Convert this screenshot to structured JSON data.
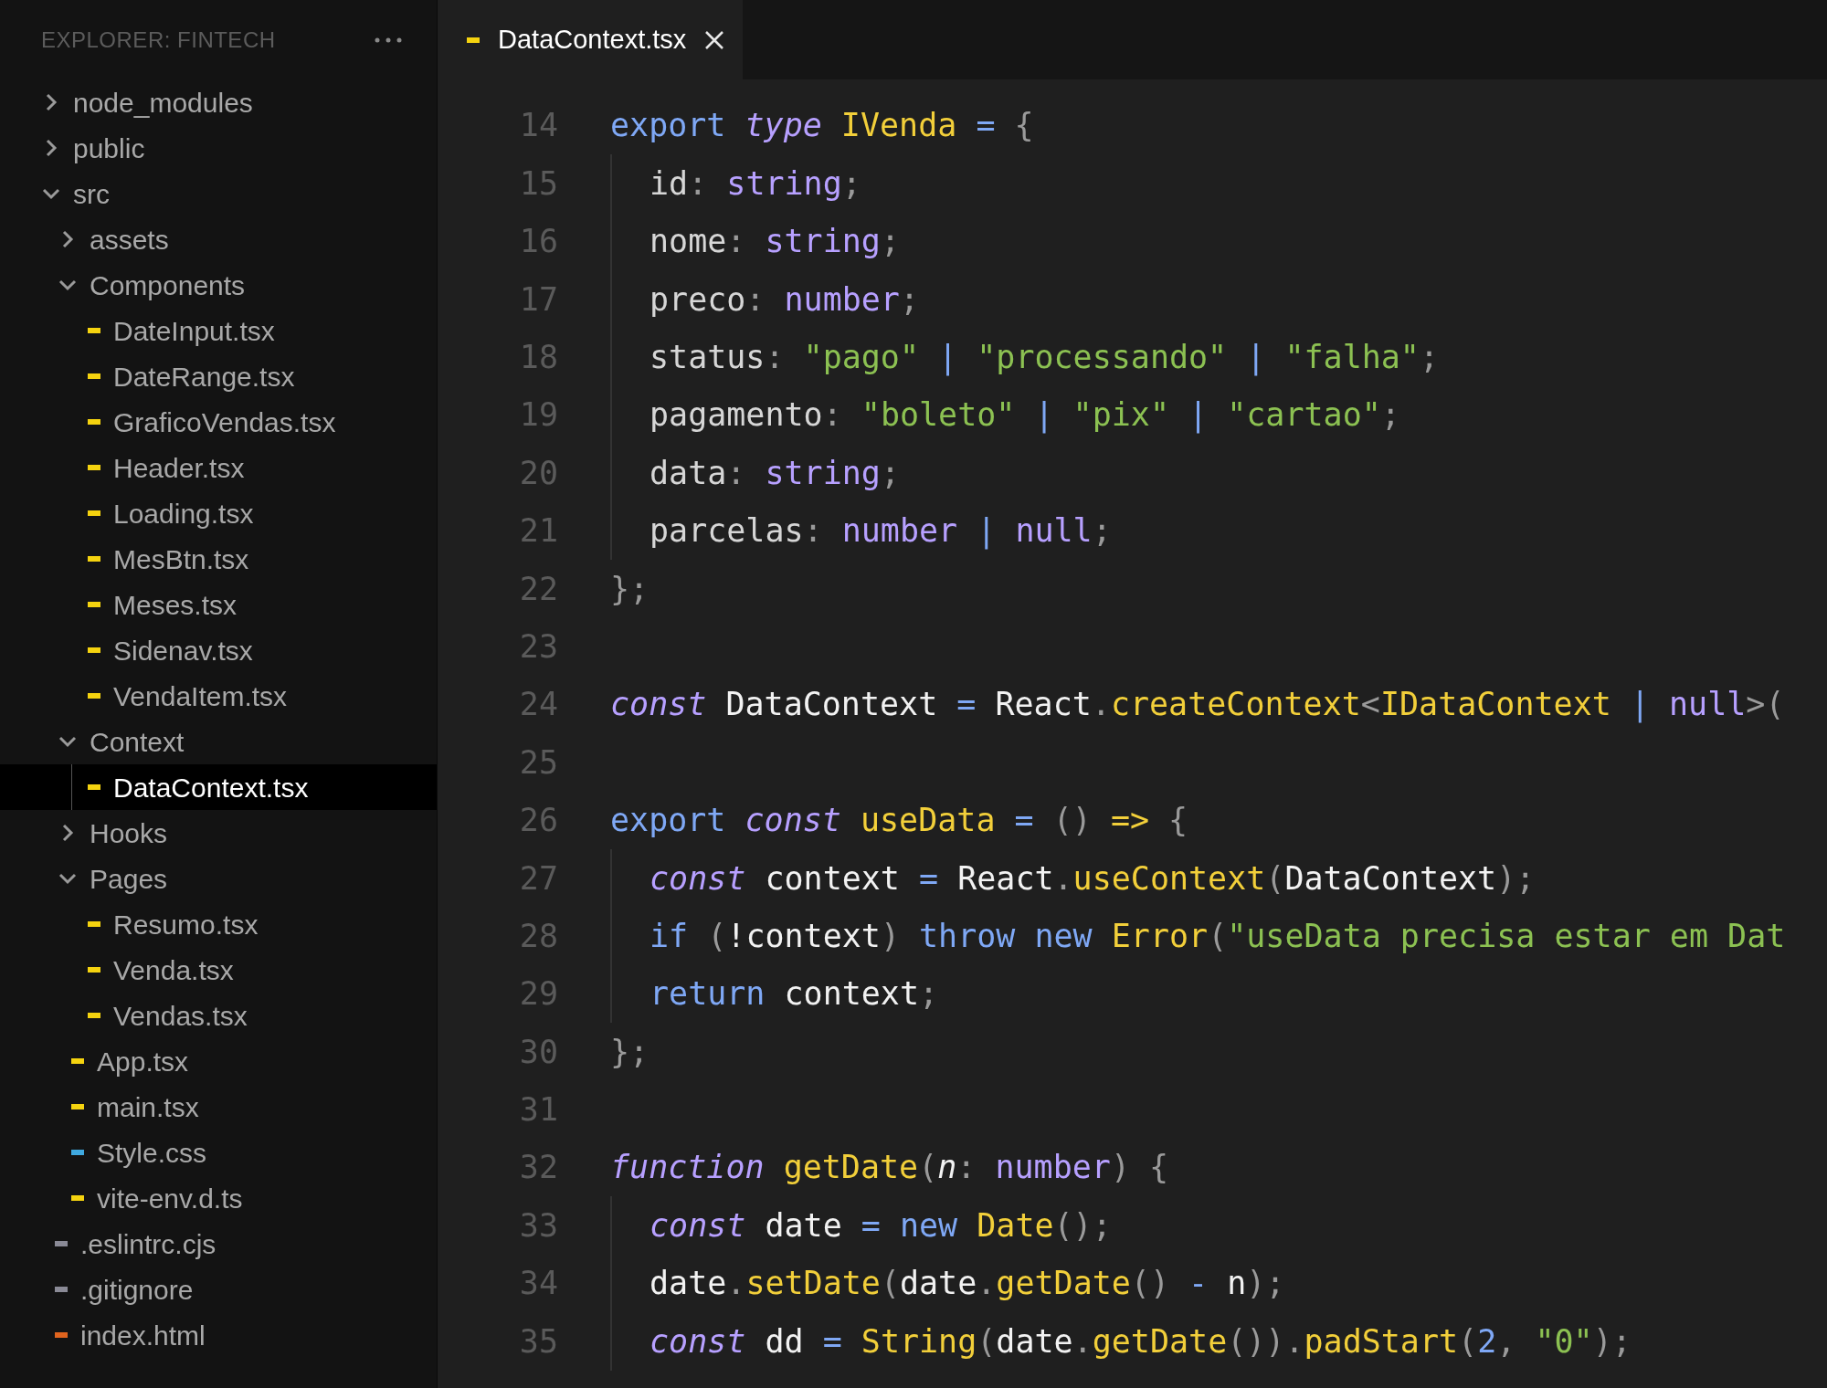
{
  "explorer": {
    "title": "EXPLORER: FINTECH",
    "tree": [
      {
        "name": "node_modules",
        "kind": "folder",
        "expanded": false,
        "selected": false
      },
      {
        "name": "public",
        "kind": "folder",
        "expanded": false,
        "selected": false
      },
      {
        "name": "src",
        "kind": "folder",
        "expanded": true,
        "selected": false,
        "children": [
          {
            "name": "assets",
            "kind": "folder",
            "expanded": false,
            "selected": false
          },
          {
            "name": "Components",
            "kind": "folder",
            "expanded": true,
            "selected": false,
            "children": [
              {
                "name": "DateInput.tsx",
                "kind": "file",
                "color": "#f5d30f",
                "selected": false
              },
              {
                "name": "DateRange.tsx",
                "kind": "file",
                "color": "#f5d30f",
                "selected": false
              },
              {
                "name": "GraficoVendas.tsx",
                "kind": "file",
                "color": "#f5d30f",
                "selected": false
              },
              {
                "name": "Header.tsx",
                "kind": "file",
                "color": "#f5d30f",
                "selected": false
              },
              {
                "name": "Loading.tsx",
                "kind": "file",
                "color": "#f5d30f",
                "selected": false
              },
              {
                "name": "MesBtn.tsx",
                "kind": "file",
                "color": "#f5d30f",
                "selected": false
              },
              {
                "name": "Meses.tsx",
                "kind": "file",
                "color": "#f5d30f",
                "selected": false
              },
              {
                "name": "Sidenav.tsx",
                "kind": "file",
                "color": "#f5d30f",
                "selected": false
              },
              {
                "name": "VendaItem.tsx",
                "kind": "file",
                "color": "#f5d30f",
                "selected": false
              }
            ]
          },
          {
            "name": "Context",
            "kind": "folder",
            "expanded": true,
            "selected": false,
            "children": [
              {
                "name": "DataContext.tsx",
                "kind": "file",
                "color": "#f5d30f",
                "selected": true
              }
            ]
          },
          {
            "name": "Hooks",
            "kind": "folder",
            "expanded": false,
            "selected": false
          },
          {
            "name": "Pages",
            "kind": "folder",
            "expanded": true,
            "selected": false,
            "children": [
              {
                "name": "Resumo.tsx",
                "kind": "file",
                "color": "#f5d30f",
                "selected": false
              },
              {
                "name": "Venda.tsx",
                "kind": "file",
                "color": "#f5d30f",
                "selected": false
              },
              {
                "name": "Vendas.tsx",
                "kind": "file",
                "color": "#f5d30f",
                "selected": false
              }
            ]
          },
          {
            "name": "App.tsx",
            "kind": "file",
            "color": "#f5d30f",
            "selected": false
          },
          {
            "name": "main.tsx",
            "kind": "file",
            "color": "#f5d30f",
            "selected": false
          },
          {
            "name": "Style.css",
            "kind": "file",
            "color": "#3fa9e0",
            "selected": false
          },
          {
            "name": "vite-env.d.ts",
            "kind": "file",
            "color": "#f5d30f",
            "selected": false
          }
        ]
      },
      {
        "name": ".eslintrc.cjs",
        "kind": "file",
        "color": "#8a8a96",
        "selected": false
      },
      {
        "name": ".gitignore",
        "kind": "file",
        "color": "#8a8a96",
        "selected": false
      },
      {
        "name": "index.html",
        "kind": "file",
        "color": "#e0641e",
        "selected": false
      }
    ]
  },
  "tabs": [
    {
      "label": "DataContext.tsx",
      "color": "#f5d30f",
      "selected": true
    }
  ],
  "code": [
    {
      "n": "14",
      "tokens": [
        {
          "text": "export",
          "kind": "kw"
        },
        {
          "text": " type",
          "kind": "st"
        },
        {
          "text": " IVenda",
          "kind": "fn"
        },
        {
          "text": " =",
          "kind": "op"
        },
        {
          "text": " {",
          "kind": "pu"
        }
      ],
      "children": [
        {
          "n": "15",
          "tokens": [
            {
              "text": "id",
              "kind": "pr"
            },
            {
              "text": ":",
              "kind": "pu"
            },
            {
              "text": " string",
              "kind": "ty"
            },
            {
              "text": ";",
              "kind": "pu"
            }
          ]
        },
        {
          "n": "16",
          "tokens": [
            {
              "text": "nome",
              "kind": "pr"
            },
            {
              "text": ":",
              "kind": "pu"
            },
            {
              "text": " string",
              "kind": "ty"
            },
            {
              "text": ";",
              "kind": "pu"
            }
          ]
        },
        {
          "n": "17",
          "tokens": [
            {
              "text": "preco",
              "kind": "pr"
            },
            {
              "text": ":",
              "kind": "pu"
            },
            {
              "text": " number",
              "kind": "ty"
            },
            {
              "text": ";",
              "kind": "pu"
            }
          ]
        },
        {
          "n": "18",
          "tokens": [
            {
              "text": "status",
              "kind": "pr"
            },
            {
              "text": ":",
              "kind": "pu"
            },
            {
              "text": " \"pago\"",
              "kind": "s"
            },
            {
              "text": " |",
              "kind": "op"
            },
            {
              "text": " \"processando\"",
              "kind": "s"
            },
            {
              "text": " |",
              "kind": "op"
            },
            {
              "text": " \"falha\"",
              "kind": "s"
            },
            {
              "text": ";",
              "kind": "pu"
            }
          ]
        },
        {
          "n": "19",
          "tokens": [
            {
              "text": "pagamento",
              "kind": "pr"
            },
            {
              "text": ":",
              "kind": "pu"
            },
            {
              "text": " \"boleto\"",
              "kind": "s"
            },
            {
              "text": " |",
              "kind": "op"
            },
            {
              "text": " \"pix\"",
              "kind": "s"
            },
            {
              "text": " |",
              "kind": "op"
            },
            {
              "text": " \"cartao\"",
              "kind": "s"
            },
            {
              "text": ";",
              "kind": "pu"
            }
          ]
        },
        {
          "n": "20",
          "tokens": [
            {
              "text": "data",
              "kind": "pr"
            },
            {
              "text": ":",
              "kind": "pu"
            },
            {
              "text": " string",
              "kind": "ty"
            },
            {
              "text": ";",
              "kind": "pu"
            }
          ]
        },
        {
          "n": "21",
          "tokens": [
            {
              "text": "parcelas",
              "kind": "pr"
            },
            {
              "text": ":",
              "kind": "pu"
            },
            {
              "text": " number",
              "kind": "ty"
            },
            {
              "text": " |",
              "kind": "op"
            },
            {
              "text": " null",
              "kind": "ty"
            },
            {
              "text": ";",
              "kind": "pu"
            }
          ]
        }
      ]
    },
    {
      "n": "22",
      "tokens": [
        {
          "text": "};",
          "kind": "pu"
        }
      ]
    },
    {
      "n": "23"
    },
    {
      "n": "24",
      "tokens": [
        {
          "text": "const",
          "kind": "st"
        },
        {
          "text": " DataContext",
          "kind": "id"
        },
        {
          "text": " =",
          "kind": "op"
        },
        {
          "text": " React",
          "kind": "id"
        },
        {
          "text": ".",
          "kind": "pu"
        },
        {
          "text": "createContext",
          "kind": "fn"
        },
        {
          "text": "<",
          "kind": "pu"
        },
        {
          "text": "IDataContext",
          "kind": "fn"
        },
        {
          "text": " |",
          "kind": "op"
        },
        {
          "text": " null",
          "kind": "ty"
        },
        {
          "text": ">(",
          "kind": "pu"
        }
      ]
    },
    {
      "n": "25"
    },
    {
      "n": "26",
      "tokens": [
        {
          "text": "export",
          "kind": "kw"
        },
        {
          "text": " const",
          "kind": "st"
        },
        {
          "text": " useData",
          "kind": "fn"
        },
        {
          "text": " =",
          "kind": "op"
        },
        {
          "text": " ()",
          "kind": "pu"
        },
        {
          "text": " =>",
          "kind": "fn"
        },
        {
          "text": " {",
          "kind": "pu"
        }
      ],
      "children": [
        {
          "n": "27",
          "tokens": [
            {
              "text": "const",
              "kind": "st"
            },
            {
              "text": " context",
              "kind": "id"
            },
            {
              "text": " =",
              "kind": "op"
            },
            {
              "text": " React",
              "kind": "id"
            },
            {
              "text": ".",
              "kind": "pu"
            },
            {
              "text": "useContext",
              "kind": "fn"
            },
            {
              "text": "(",
              "kind": "pu"
            },
            {
              "text": "DataContext",
              "kind": "id"
            },
            {
              "text": ");",
              "kind": "pu"
            }
          ]
        },
        {
          "n": "28",
          "tokens": [
            {
              "text": "if",
              "kind": "kw"
            },
            {
              "text": " (",
              "kind": "pu"
            },
            {
              "text": "!context",
              "kind": "id"
            },
            {
              "text": ")",
              "kind": "pu"
            },
            {
              "text": " throw new",
              "kind": "kw"
            },
            {
              "text": " Error",
              "kind": "fn"
            },
            {
              "text": "(",
              "kind": "pu"
            },
            {
              "text": "\"useData precisa estar em Dat",
              "kind": "s"
            }
          ]
        },
        {
          "n": "29",
          "tokens": [
            {
              "text": "return",
              "kind": "kw"
            },
            {
              "text": " context",
              "kind": "id"
            },
            {
              "text": ";",
              "kind": "pu"
            }
          ]
        }
      ]
    },
    {
      "n": "30",
      "tokens": [
        {
          "text": "};",
          "kind": "pu"
        }
      ]
    },
    {
      "n": "31"
    },
    {
      "n": "32",
      "tokens": [
        {
          "text": "function",
          "kind": "st"
        },
        {
          "text": " getDate",
          "kind": "fn"
        },
        {
          "text": "(",
          "kind": "pu"
        },
        {
          "text": "n",
          "kind": "pi"
        },
        {
          "text": ":",
          "kind": "pu"
        },
        {
          "text": " number",
          "kind": "ty"
        },
        {
          "text": ") {",
          "kind": "pu"
        }
      ],
      "children": [
        {
          "n": "33",
          "tokens": [
            {
              "text": "const",
              "kind": "st"
            },
            {
              "text": " date",
              "kind": "id"
            },
            {
              "text": " =",
              "kind": "op"
            },
            {
              "text": " new",
              "kind": "kw"
            },
            {
              "text": " Date",
              "kind": "fn"
            },
            {
              "text": "();",
              "kind": "pu"
            }
          ]
        },
        {
          "n": "34",
          "tokens": [
            {
              "text": "date",
              "kind": "id"
            },
            {
              "text": ".",
              "kind": "pu"
            },
            {
              "text": "setDate",
              "kind": "fn"
            },
            {
              "text": "(",
              "kind": "pu"
            },
            {
              "text": "date",
              "kind": "id"
            },
            {
              "text": ".",
              "kind": "pu"
            },
            {
              "text": "getDate",
              "kind": "fn"
            },
            {
              "text": "()",
              "kind": "pu"
            },
            {
              "text": " -",
              "kind": "op"
            },
            {
              "text": " n",
              "kind": "id"
            },
            {
              "text": ");",
              "kind": "pu"
            }
          ]
        },
        {
          "n": "35",
          "tokens": [
            {
              "text": "const",
              "kind": "st"
            },
            {
              "text": " dd",
              "kind": "id"
            },
            {
              "text": " =",
              "kind": "op"
            },
            {
              "text": " String",
              "kind": "fn"
            },
            {
              "text": "(",
              "kind": "pu"
            },
            {
              "text": "date",
              "kind": "id"
            },
            {
              "text": ".",
              "kind": "pu"
            },
            {
              "text": "getDate",
              "kind": "fn"
            },
            {
              "text": "())",
              "kind": "pu"
            },
            {
              "text": ".",
              "kind": "pu"
            },
            {
              "text": "padStart",
              "kind": "fn"
            },
            {
              "text": "(",
              "kind": "pu"
            },
            {
              "text": "2",
              "kind": "num"
            },
            {
              "text": ",",
              "kind": "pu"
            },
            {
              "text": " \"0\"",
              "kind": "s"
            },
            {
              "text": ");",
              "kind": "pu"
            }
          ]
        }
      ]
    }
  ]
}
